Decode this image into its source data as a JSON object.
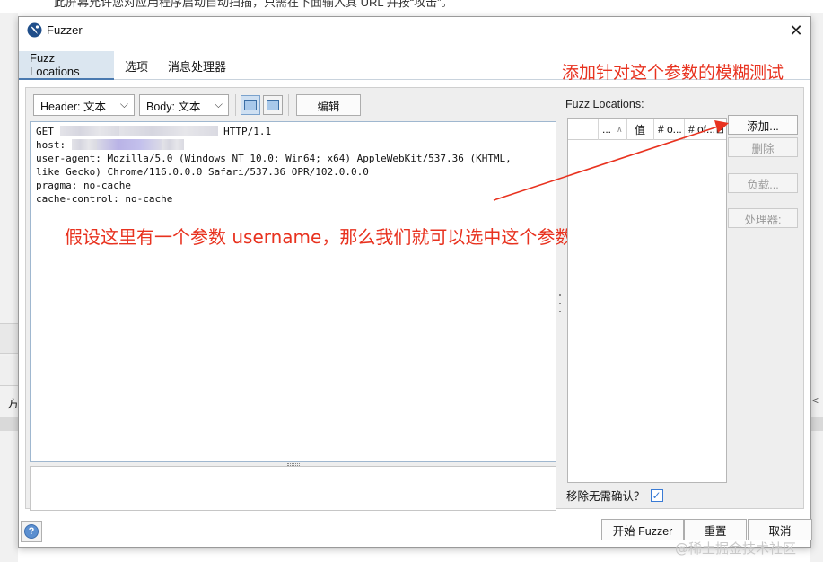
{
  "background": {
    "top_text": "此屏幕允许您对应用程序启动自动扫描，只需在下面输入其 URL 并按“攻击”。",
    "left_fragment": "方",
    "right_fragment": "<"
  },
  "window": {
    "title": "Fuzzer",
    "close_glyph": "✕"
  },
  "tabs": [
    {
      "label": "Fuzz Locations",
      "active": true
    },
    {
      "label": "选项",
      "active": false
    },
    {
      "label": "消息处理器",
      "active": false
    }
  ],
  "toolbar": {
    "header_select": "Header: 文本",
    "body_select": "Body: 文本",
    "edit_button": "编辑"
  },
  "request": {
    "line1_method": "GET",
    "line1_version": "HTTP/1.1",
    "line2_key": "host:",
    "line3": "user-agent: Mozilla/5.0 (Windows NT 10.0; Win64; x64) AppleWebKit/537.36 (KHTML,",
    "line4": "like Gecko) Chrome/116.0.0.0 Safari/537.36 OPR/102.0.0.0",
    "line5": "pragma: no-cache",
    "line6": "cache-control: no-cache"
  },
  "fuzz_locations": {
    "label": "Fuzz Locations:",
    "columns": [
      "...",
      "值",
      "# o...",
      "# of..."
    ],
    "rows": []
  },
  "side_buttons": {
    "add": "添加...",
    "remove": "删除",
    "payloads": "负载...",
    "processors": "处理器:"
  },
  "confirm": {
    "label": "移除无需确认？",
    "checked": true,
    "check_glyph": "✓"
  },
  "bottom_buttons": {
    "help": "?",
    "start": "开始 Fuzzer",
    "reset": "重置",
    "cancel": "取消"
  },
  "annotations": {
    "top": "添加针对这个参数的模糊测试",
    "middle": "假设这里有一个参数 username，那么我们就可以选中这个参数",
    "color": "#e8321f"
  },
  "watermark": "@稀土掘金技术社区",
  "colors": {
    "active_tab": "#dbe6f0",
    "panel_bg": "#eeeeee",
    "editor_border": "#9fb7cf",
    "checkbox": "#3a7bd5"
  }
}
